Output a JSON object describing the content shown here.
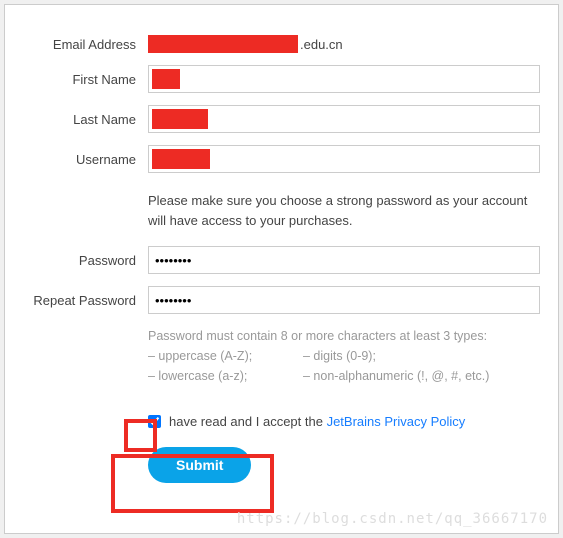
{
  "form": {
    "email_label": "Email Address",
    "email_suffix": ".edu.cn",
    "first_name_label": "First Name",
    "last_name_label": "Last Name",
    "username_label": "Username",
    "password_label": "Password",
    "repeat_password_label": "Repeat Password",
    "password_value": "••••••••",
    "repeat_password_value": "••••••••"
  },
  "helper_text": "Please make sure you choose a strong password as your account will have access to your purchases.",
  "hint": {
    "header": "Password must contain 8 or more characters at least 3 types:",
    "r1c1": "– uppercase (A-Z);",
    "r1c2": "– digits (0-9);",
    "r2c1": "– lowercase (a-z);",
    "r2c2": "– non-alphanumeric (!, @, #, etc.)"
  },
  "agree": {
    "prefix": "have read and I accept the ",
    "link_text": "JetBrains Privacy Policy"
  },
  "submit_label": "Submit",
  "watermark": "https://blog.csdn.net/qq_36667170"
}
